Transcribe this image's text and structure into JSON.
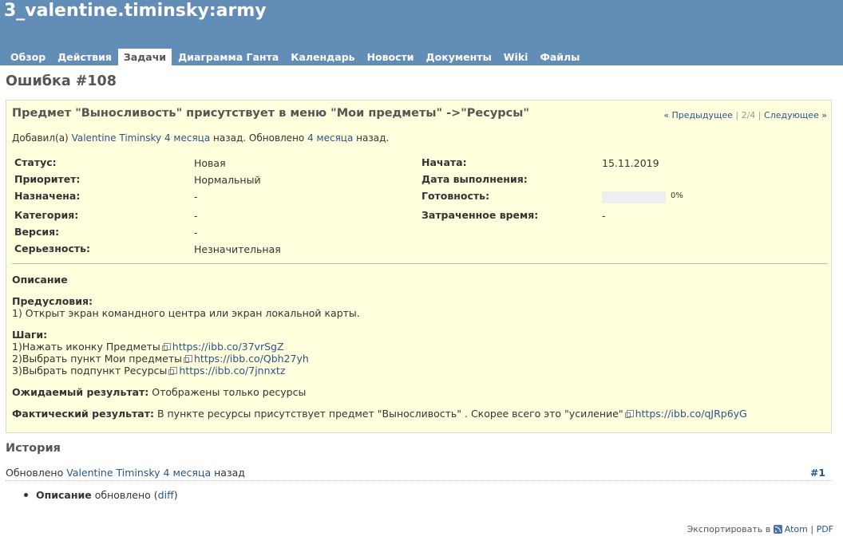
{
  "header": {
    "project_title": "3_valentine.timinsky:army",
    "tabs": [
      {
        "label": "Обзор"
      },
      {
        "label": "Действия"
      },
      {
        "label": "Задачи"
      },
      {
        "label": "Диаграмма Ганта"
      },
      {
        "label": "Календарь"
      },
      {
        "label": "Новости"
      },
      {
        "label": "Документы"
      },
      {
        "label": "Wiki"
      },
      {
        "label": "Файлы"
      }
    ],
    "selected_tab": "Задачи"
  },
  "page": {
    "heading": "Ошибка #108"
  },
  "issue": {
    "subject": "Предмет \"Выносливость\" присутствует в меню \"Мои предметы\" ->\"Ресурсы\"",
    "nav": {
      "prev": "« Предыдущее",
      "position": "2/4",
      "next": "Следующее »"
    },
    "author_line": {
      "prefix": "Добавил(а)",
      "author": "Valentine Timinsky",
      "added_ago": "4 месяца",
      "middle": "назад. Обновлено",
      "updated_ago": "4 месяца",
      "suffix": "назад."
    },
    "attributes": {
      "status": {
        "label": "Статус:",
        "value": "Новая"
      },
      "priority": {
        "label": "Приоритет:",
        "value": "Нормальный"
      },
      "assigned": {
        "label": "Назначена:",
        "value": "-"
      },
      "category": {
        "label": "Категория:",
        "value": "-"
      },
      "version": {
        "label": "Версия:",
        "value": "-"
      },
      "severity": {
        "label": "Серьезность:",
        "value": "Незначительная"
      },
      "start_date": {
        "label": "Начата:",
        "value": "15.11.2019"
      },
      "due_date": {
        "label": "Дата выполнения:",
        "value": ""
      },
      "done": {
        "label": "Готовность:",
        "value": "0%",
        "fraction": 0
      },
      "spent_time": {
        "label": "Затраченное время:",
        "value": "-"
      }
    },
    "description": {
      "title": "Описание",
      "preconditions_label": "Предусловия:",
      "preconditions_text": "1) Открыт экран командного центра или экран локальной карты.",
      "steps_label": "Шаги:",
      "steps": [
        {
          "text": "1)Нажать иконку Предметы",
          "link": "https://ibb.co/37vrSgZ"
        },
        {
          "text": "2)Выбрать пункт Мои предметы",
          "link": "https://ibb.co/Qbh27yh"
        },
        {
          "text": "3)Выбрать подпункт Ресурсы",
          "link": "https://ibb.co/7jnnxtz"
        }
      ],
      "expected_label": "Ожидаемый результат:",
      "expected_text": "Отображены только ресурсы",
      "actual_label": "Фактический результат:",
      "actual_text": "В пункте ресурсы присутствует предмет \"Выносливость\" . Скорее всего это \"усиление\"",
      "actual_link": "https://ibb.co/qJRp6yG"
    }
  },
  "history": {
    "title": "История",
    "entry": {
      "prefix": "Обновлено",
      "author": "Valentine Timinsky",
      "ago": "4 месяца",
      "suffix": "назад",
      "number": "#1",
      "detail_field": "Описание",
      "detail_text": "обновлено",
      "detail_open": "(",
      "detail_link": "diff",
      "detail_close": ")"
    }
  },
  "footer": {
    "export_label": "Экспортировать в",
    "atom": "Atom",
    "separator": "|",
    "pdf": "PDF"
  },
  "colors": {
    "header_bg": "#628db6",
    "issue_bg": "#ffffdd",
    "link": "#2a5685"
  }
}
